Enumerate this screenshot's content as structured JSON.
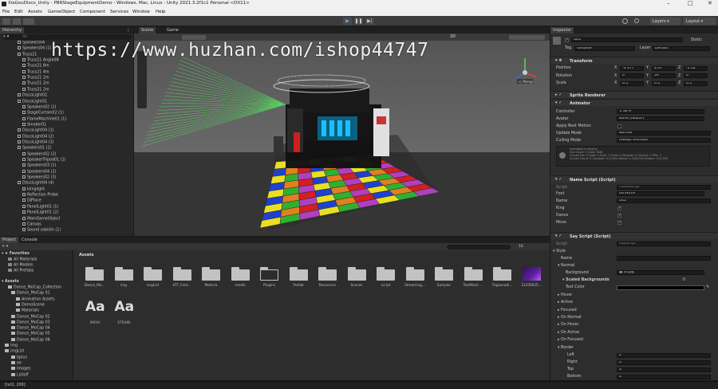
{
  "window": {
    "title": "XiaGouDisco_Unity - PBRStageEquipmentDemo - Windows, Mac, Linux - Unity 2021.3.2f1c1 Personal <DX11>",
    "minimize": "–",
    "maximize": "□",
    "close": "✕"
  },
  "menu": [
    "File",
    "Edit",
    "Assets",
    "GameObject",
    "Component",
    "Services",
    "Window",
    "Help"
  ],
  "toolbar": {
    "layers": "Layers",
    "layout": "Layout"
  },
  "hierarchy": {
    "tab": "Hierarchy",
    "search_placeholder": "All",
    "items": [
      "Speakers04",
      "Speakers04 (1)",
      "Truss21",
      "Truss21 Angle08",
      "Truss21 8m",
      "Truss21 4m",
      "Truss21 2m",
      "Truss21 2m",
      "Truss21 2m",
      "DiscoLight02",
      "DiscoLight01",
      "Speakers02 (1)",
      "StageCurtain02 (1)",
      "FlameMachine01 (1)",
      "Smoker01",
      "DiscoLight04 (1)",
      "DiscoLight04 (2)",
      "DiscoLight04 (3)",
      "Speakers01 (1)",
      "Speakers02 (2)",
      "SpeakerTripod01 (1)",
      "Speakers03 (1)",
      "Speakers04 (2)",
      "Speakers02 (3)",
      "DiscoLight04 (4)",
      "klinglight",
      "Reflection Probe",
      "DjPlace",
      "PanelLight01 (1)",
      "PanelLight01 (2)",
      "MainGameObject",
      "Canvas",
      "Sound sabidin (1)"
    ]
  },
  "scene": {
    "tabs": [
      "Scene",
      "Game"
    ],
    "view_mode": "Persp",
    "zoom": "2D"
  },
  "watermark": "https://www.huzhan.com/ishop44747",
  "project": {
    "tabs": [
      "Project",
      "Console"
    ],
    "favorites_label": "Favorites",
    "favorites": [
      "All Materials",
      "All Models",
      "All Prefabs"
    ],
    "assets_label": "Assets",
    "tree": [
      "Dance_MoCap_Collection",
      "Dance_MoCap 01",
      "Animation Assets",
      "DemoScene",
      "Materials",
      "Dance_MoCap 02",
      "Dance_MoCap 03",
      "Dance_MoCap 04",
      "Dance_MoCap 05",
      "Dance_MoCap 06",
      "img",
      "imgList",
      "bplus",
      "ee",
      "images",
      "Listoff"
    ],
    "breadcrumb": "Assets",
    "asset_items": [
      "Dance_Mo...",
      "img",
      "imgList",
      "KTF_Font...",
      "Materia",
      "model",
      "Plugins",
      "Prefab",
      "Resources",
      "Scenes",
      "script",
      "Streaming...",
      "Sampler",
      "TextMesh ...",
      "Trigaonadi...",
      "21200835..."
    ],
    "font_assets": [
      "MSYH",
      "STXIHEI"
    ],
    "font_glyph": "Aa",
    "count": "16"
  },
  "inspector": {
    "tab": "Inspector",
    "object_name": "txt2",
    "static_label": "Static",
    "tag_label": "Tag",
    "tag_value": "fontblue",
    "layer_label": "Layer",
    "layer_value": "Default",
    "transform": {
      "title": "Transform",
      "rows": [
        {
          "label": "Position",
          "x": "-3.377",
          "y": "2.07",
          "z": "-5.52"
        },
        {
          "label": "Rotation",
          "x": "0",
          "y": "39",
          "z": "0"
        },
        {
          "label": "Scale",
          "x": "0.5",
          "y": "0.5",
          "z": "0.5"
        }
      ]
    },
    "sprite_renderer": "Sprite Renderer",
    "animator": {
      "title": "Animator",
      "controller_label": "Controller",
      "controller_value": "bk-9",
      "avatar_label": "Avatar",
      "avatar_value": "None (Avatar)",
      "apply_root_label": "Apply Root Motion",
      "update_label": "Update Mode",
      "update_value": "Normal",
      "culling_label": "Culling Mode",
      "culling_value": "Always Animate",
      "info": [
        "Animation is playing",
        "Clip Count: 1  (Size: 0KB)",
        "Curves Pos: 0 Quat: 0 Euler: 0 Scale: 0 Muscles: 0 Generic: 1 PPtr: 1",
        "Curves Count: 2 Constant: 0 (0.0%) Dense: 2 (100.0%) Stream: 0 (0.0%)"
      ]
    },
    "name_script": {
      "title": "Name Script (Script)",
      "script_label": "Script",
      "script_value": "nameScript",
      "font_label": "Font",
      "font_value": "MSYH",
      "name_label": "Name",
      "name_value": "txt2",
      "king_label": "King",
      "dance_label": "Dance",
      "move_label": "Move"
    },
    "say_script": {
      "title": "Say Script (Script)",
      "script_label": "Script",
      "script_value": "sayScript",
      "style_label": "Style",
      "name_label": "Name",
      "normal_label": "Normal",
      "background_label": "Background",
      "background_value": "对话框",
      "scaled_bg_label": "Scaled Backgrounds",
      "scaled_bg_value": "0",
      "text_color_label": "Text Color",
      "states": [
        "Hover",
        "Active",
        "Focused",
        "On Normal",
        "On Hover",
        "On Active",
        "On Focused"
      ],
      "border_label": "Border",
      "border_rows": [
        {
          "label": "Left",
          "value": "0"
        },
        {
          "label": "Right",
          "value": "0"
        },
        {
          "label": "Top",
          "value": "0"
        },
        {
          "label": "Bottom",
          "value": "0"
        }
      ]
    }
  },
  "status_bar": {
    "text": "[txt2, 200]"
  }
}
